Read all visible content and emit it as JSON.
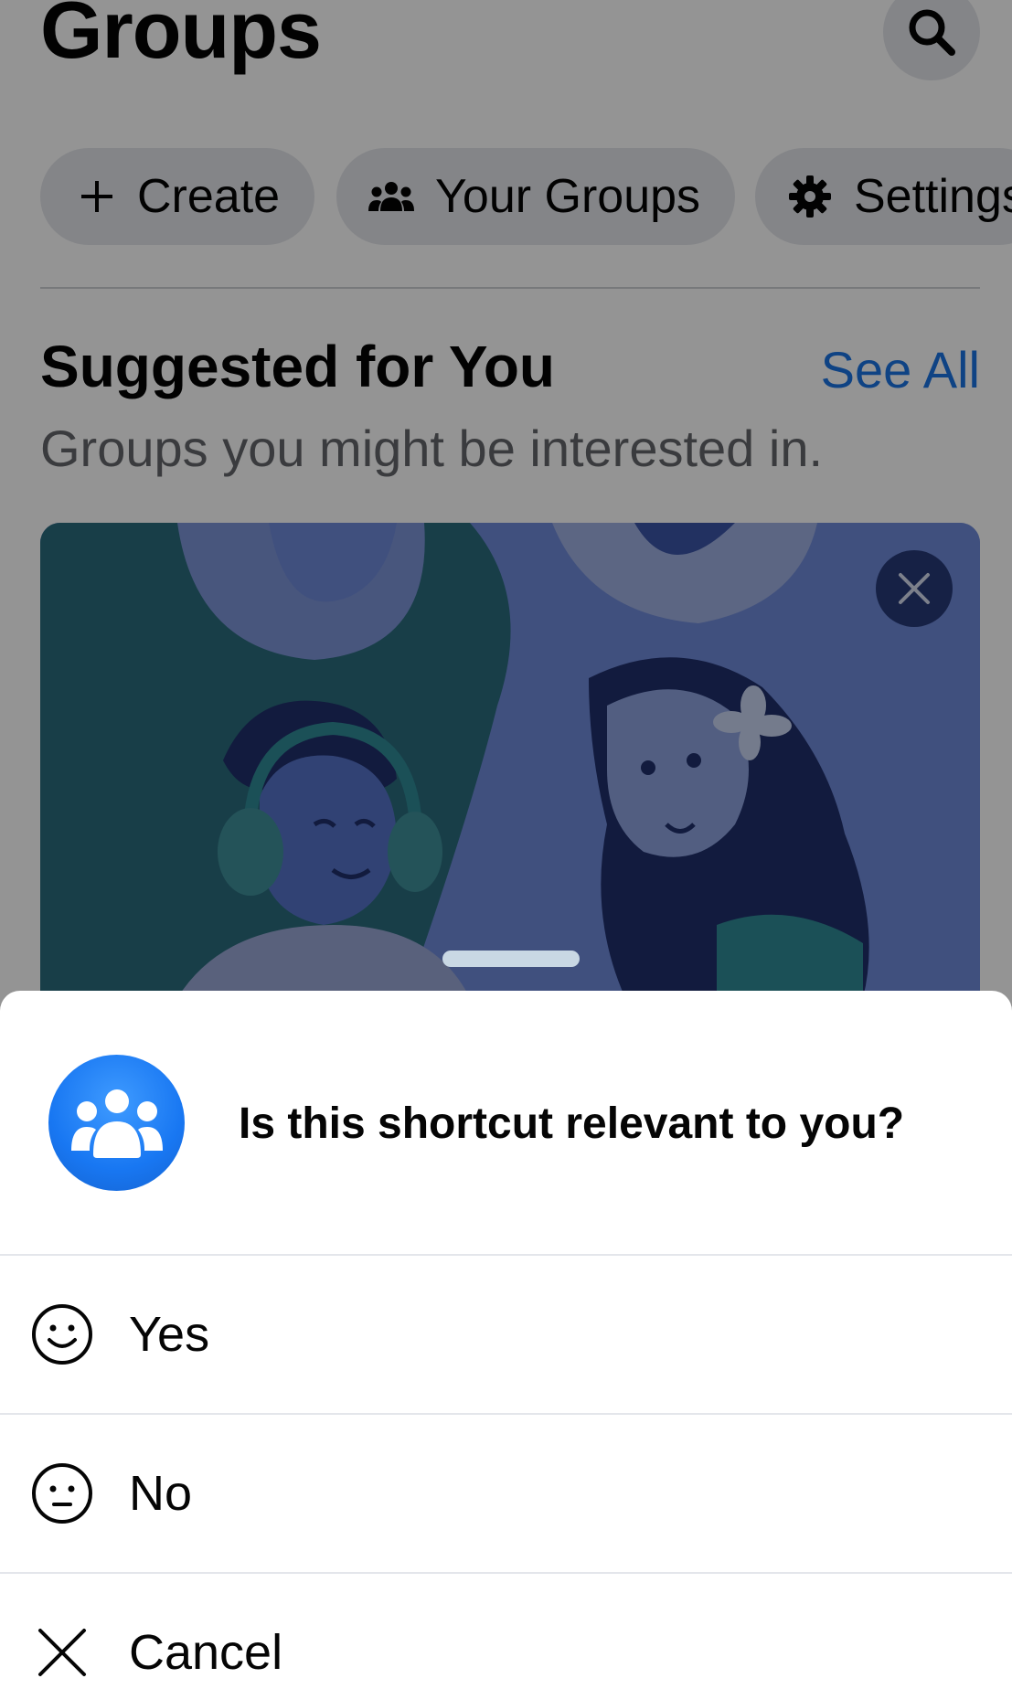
{
  "header": {
    "title": "Groups",
    "search_icon": "search-icon"
  },
  "pills": {
    "create_label": "Create",
    "your_groups_label": "Your Groups",
    "settings_label": "Settings"
  },
  "suggested": {
    "title": "Suggested for You",
    "see_all": "See All",
    "subtitle": "Groups you might be interested in."
  },
  "sheet": {
    "question": "Is this shortcut relevant to you?",
    "options": [
      {
        "label": "Yes",
        "icon": "smile-icon"
      },
      {
        "label": "No",
        "icon": "neutral-face-icon"
      },
      {
        "label": "Cancel",
        "icon": "close-icon"
      }
    ]
  },
  "colors": {
    "accent": "#1b74e4",
    "avatar_blue": "#1877f2",
    "pill_bg": "#e4e6eb"
  }
}
